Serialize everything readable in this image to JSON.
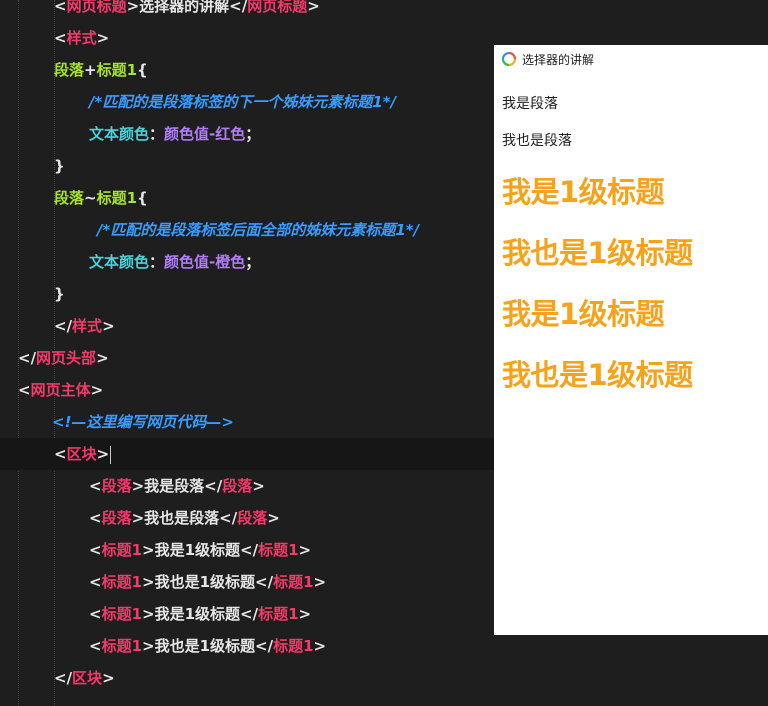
{
  "editor": {
    "l0": {
      "open1": "<",
      "tag1": "网页标题",
      "mid": ">选择器的讲解</",
      "tag2": "网页标题",
      "end": ">"
    },
    "l1": {
      "open": "<",
      "tag": "样式",
      "close": ">"
    },
    "l2": {
      "sel": "段落",
      "plus": "+",
      "sel2": "标题1",
      "brace": "{"
    },
    "l3": {
      "comment": "/*匹配的是段落标签的下一个姊妹元素标题1*/"
    },
    "l4": {
      "prop": "文本颜色",
      "colon": "：",
      "value": "颜色值-红色",
      "semi": "；"
    },
    "l5": {
      "brace": "}"
    },
    "l6": {
      "sel": "段落",
      "tilde": "~",
      "sel2": "标题1",
      "brace": "{"
    },
    "l7": {
      "comment": "/*匹配的是段落标签后面全部的姊妹元素标题1*/"
    },
    "l8": {
      "prop": "文本颜色",
      "colon": "：",
      "value": "颜色值-橙色",
      "semi": "；"
    },
    "l9": {
      "brace": "}"
    },
    "l10": {
      "open": "</",
      "tag": "样式",
      "close": ">"
    },
    "l11": {
      "open": "</",
      "tag": "网页头部",
      "close": ">"
    },
    "l12": {
      "open": "<",
      "tag": "网页主体",
      "close": ">"
    },
    "l13": {
      "comment": "<!—这里编写网页代码—>"
    },
    "l14": {
      "open": "<",
      "tag": "区块",
      "close": ">"
    },
    "l15": {
      "open1": "<",
      "tag1": "段落",
      "mid": ">我是段落</",
      "tag2": "段落",
      "end": ">"
    },
    "l16": {
      "open1": "<",
      "tag1": "段落",
      "mid": ">我也是段落</",
      "tag2": "段落",
      "end": ">"
    },
    "l17": {
      "open1": "<",
      "tag1": "标题1",
      "mid": ">我是1级标题</",
      "tag2": "标题1",
      "end": ">"
    },
    "l18": {
      "open1": "<",
      "tag1": "标题1",
      "mid": ">我也是1级标题</",
      "tag2": "标题1",
      "end": ">"
    },
    "l19": {
      "open1": "<",
      "tag1": "标题1",
      "mid": ">我是1级标题</",
      "tag2": "标题1",
      "end": ">"
    },
    "l20": {
      "open1": "<",
      "tag1": "标题1",
      "mid": ">我也是1级标题</",
      "tag2": "标题1",
      "end": ">"
    },
    "l21": {
      "open": "</",
      "tag": "区块",
      "close": ">"
    }
  },
  "preview": {
    "tab_title": "选择器的讲解",
    "p1": "我是段落",
    "p2": "我也是段落",
    "h1": "我是1级标题",
    "h2": "我也是1级标题",
    "h3": "我是1级标题",
    "h4": "我也是1级标题",
    "heading_color": "#f7a21b"
  }
}
